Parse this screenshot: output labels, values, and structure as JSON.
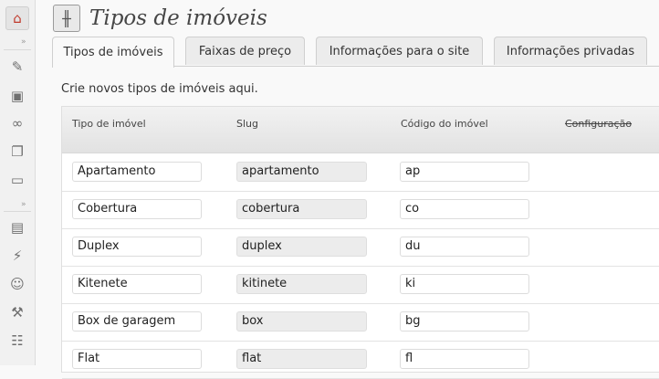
{
  "page": {
    "title": "Tipos de imóveis",
    "intro": "Crie novos tipos de imóveis aqui."
  },
  "tabs": [
    {
      "label": "Tipos de imóveis",
      "active": true
    },
    {
      "label": "Faixas de preço",
      "active": false
    },
    {
      "label": "Informações para o site",
      "active": false
    },
    {
      "label": "Informações privadas",
      "active": false
    }
  ],
  "table": {
    "headers": [
      "Tipo de imóvel",
      "Slug",
      "Código do imóvel",
      "Configuração"
    ],
    "rows": [
      {
        "name": "Apartamento",
        "slug": "apartamento",
        "code": "ap"
      },
      {
        "name": "Cobertura",
        "slug": "cobertura",
        "code": "co"
      },
      {
        "name": "Duplex",
        "slug": "duplex",
        "code": "du"
      },
      {
        "name": "Kitenete",
        "slug": "kitinete",
        "code": "ki"
      },
      {
        "name": "Box de garagem",
        "slug": "box",
        "code": "bg"
      },
      {
        "name": "Flat",
        "slug": "flat",
        "code": "fl"
      }
    ]
  },
  "sidebar": {
    "icons": [
      "home-icon",
      "pin-icon",
      "media-icon",
      "links-icon",
      "pages-icon",
      "comments-icon",
      "appearance-icon",
      "plugins-icon",
      "users-icon",
      "tools-icon",
      "settings-icon"
    ]
  }
}
